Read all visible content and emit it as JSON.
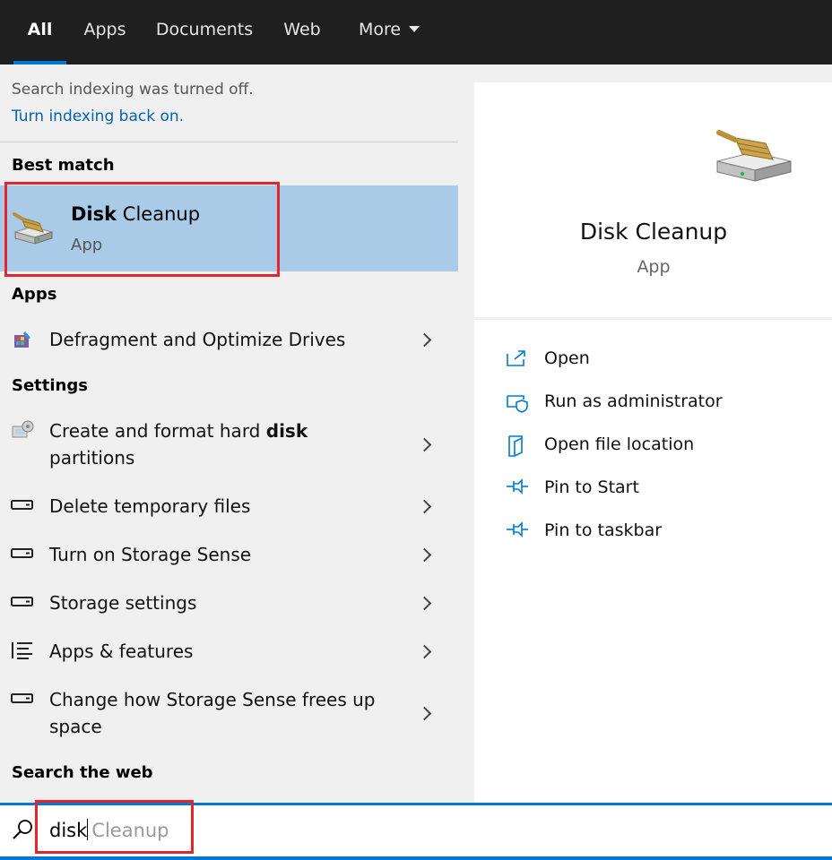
{
  "tabs": [
    {
      "label": "All",
      "active": true
    },
    {
      "label": "Apps"
    },
    {
      "label": "Documents"
    },
    {
      "label": "Web"
    },
    {
      "label": "More"
    }
  ],
  "notice": {
    "text": "Search indexing was turned off.",
    "link": "Turn indexing back on."
  },
  "best_match": {
    "header": "Best match",
    "title_bold": "Disk",
    "title_rest": " Cleanup",
    "subtitle": "App",
    "icon": "disk-cleanup-icon"
  },
  "apps": {
    "header": "Apps",
    "items": [
      {
        "label": "Defragment and Optimize Drives",
        "icon": "defragment-icon"
      }
    ]
  },
  "settings": {
    "header": "Settings",
    "items": [
      {
        "label_pre": "Create and format hard ",
        "label_bold": "disk",
        "label_line2": "partitions",
        "icon": "computer-management-icon"
      },
      {
        "label": "Delete temporary files",
        "icon": "storage-icon"
      },
      {
        "label": "Turn on Storage Sense",
        "icon": "storage-icon"
      },
      {
        "label": "Storage settings",
        "icon": "storage-icon"
      },
      {
        "label": "Apps & features",
        "icon": "list-icon"
      },
      {
        "label_line1": "Change how Storage Sense frees up",
        "label_line2": "space",
        "icon": "storage-icon"
      }
    ]
  },
  "web": {
    "header": "Search the web"
  },
  "preview": {
    "title": "Disk Cleanup",
    "subtitle": "App",
    "actions": [
      {
        "label": "Open",
        "icon": "open-icon"
      },
      {
        "label": "Run as administrator",
        "icon": "shield-icon"
      },
      {
        "label": "Open file location",
        "icon": "file-location-icon"
      },
      {
        "label": "Pin to Start",
        "icon": "pin-icon"
      },
      {
        "label": "Pin to taskbar",
        "icon": "pin-icon"
      }
    ]
  },
  "search": {
    "typed": "disk",
    "suggestion": "Cleanup"
  },
  "colors": {
    "accent": "#0078d7",
    "selection": "#a9cbe8",
    "highlight_box": "#e3262c",
    "topbar": "#1f1f1f"
  }
}
